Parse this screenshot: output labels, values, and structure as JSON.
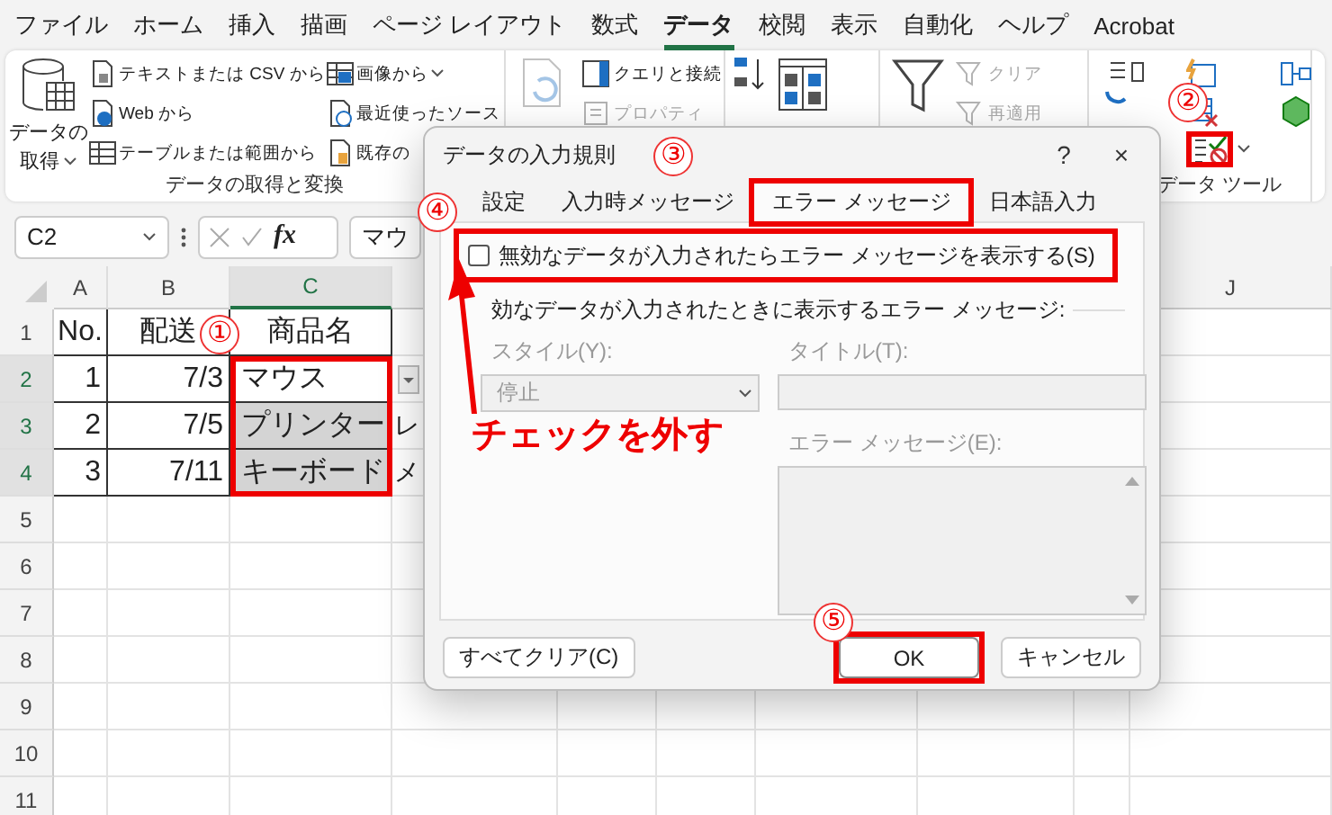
{
  "menu_tabs": [
    {
      "label": "ファイル",
      "selected": false
    },
    {
      "label": "ホーム",
      "selected": false
    },
    {
      "label": "挿入",
      "selected": false
    },
    {
      "label": "描画",
      "selected": false
    },
    {
      "label": "ページ レイアウト",
      "selected": false
    },
    {
      "label": "数式",
      "selected": false
    },
    {
      "label": "データ",
      "selected": true
    },
    {
      "label": "校閲",
      "selected": false
    },
    {
      "label": "表示",
      "selected": false
    },
    {
      "label": "自動化",
      "selected": false
    },
    {
      "label": "ヘルプ",
      "selected": false
    },
    {
      "label": "Acrobat",
      "selected": false
    }
  ],
  "ribbon": {
    "groups": [
      {
        "label": "データの取得と変換",
        "columns": [
          [
            {
              "kind": "large",
              "lines": [
                "データの",
                "取得"
              ],
              "caret": true,
              "disabled": false
            }
          ],
          [
            {
              "kind": "small",
              "label": "テキストまたは CSV から",
              "disabled": false
            },
            {
              "kind": "small",
              "label": "Web から",
              "disabled": false
            },
            {
              "kind": "small",
              "label": "テーブルまたは範囲から",
              "disabled": false
            }
          ],
          [
            {
              "kind": "small",
              "label": "画像から",
              "caret": true,
              "disabled": false
            },
            {
              "kind": "small",
              "label": "最近使ったソース",
              "disabled": false
            },
            {
              "kind": "small",
              "label": "既存の",
              "disabled": false
            }
          ]
        ]
      },
      {
        "columns": [
          [
            {
              "kind": "large",
              "disabled": true
            }
          ],
          [
            {
              "kind": "small",
              "label": "クエリと接続",
              "disabled": false
            },
            {
              "kind": "small",
              "label": "プロパティ",
              "disabled": true
            }
          ]
        ]
      },
      {
        "columns": [
          [
            {
              "kind": "icon",
              "disabled": false
            }
          ],
          [
            {
              "kind": "large",
              "disabled": false
            }
          ]
        ]
      },
      {
        "columns": [
          [
            {
              "kind": "large",
              "disabled": false
            }
          ],
          [
            {
              "kind": "small",
              "label": "クリア",
              "disabled": true
            },
            {
              "kind": "small",
              "label": "再適用",
              "disabled": true
            }
          ]
        ]
      },
      {
        "label": "データ ツール",
        "columns": [
          [
            {
              "kind": "large",
              "disabled": false
            }
          ],
          [
            {
              "kind": "icon",
              "disabled": false
            },
            {
              "kind": "icon",
              "disabled": false
            },
            {
              "kind": "icon",
              "caret": true,
              "disabled": false
            }
          ],
          [
            {
              "kind": "icon",
              "disabled": false
            },
            {
              "kind": "icon",
              "disabled": false
            }
          ]
        ]
      }
    ]
  },
  "formula_bar": {
    "name_box": "C2",
    "function_label": "fx",
    "content": "マウ"
  },
  "sheet": {
    "columns": [
      {
        "label": "A",
        "selected": false
      },
      {
        "label": "B",
        "selected": false
      },
      {
        "label": "C",
        "selected": true
      },
      {
        "label": "J",
        "selected": false
      }
    ],
    "rows": [
      {
        "header": "1",
        "selected": false,
        "cells": [
          {
            "text": "No.",
            "selected": false
          },
          {
            "text": "配送",
            "selected": false
          },
          {
            "text": "商品名",
            "selected": false
          }
        ]
      },
      {
        "header": "2",
        "selected": true,
        "cells": [
          {
            "text": "1",
            "selected": false
          },
          {
            "text": "7/3",
            "selected": false
          },
          {
            "text": "マウス",
            "selected": false
          },
          {
            "kind": "dropdown"
          }
        ]
      },
      {
        "header": "3",
        "selected": true,
        "cells": [
          {
            "text": "2",
            "selected": false
          },
          {
            "text": "7/5",
            "selected": false
          },
          {
            "text": "プリンター",
            "selected": true
          },
          {
            "text": "レ"
          }
        ]
      },
      {
        "header": "4",
        "selected": true,
        "cells": [
          {
            "text": "3",
            "selected": false
          },
          {
            "text": "7/11",
            "selected": false
          },
          {
            "text": "キーボード",
            "selected": true
          },
          {
            "text": "メ"
          }
        ]
      },
      {
        "header": "5",
        "selected": false
      },
      {
        "header": "6",
        "selected": false
      },
      {
        "header": "7",
        "selected": false
      },
      {
        "header": "8",
        "selected": false
      },
      {
        "header": "9",
        "selected": false
      },
      {
        "header": "10",
        "selected": false
      },
      {
        "header": "11",
        "selected": false
      }
    ]
  },
  "dialog": {
    "title": "データの入力規則",
    "help": "?",
    "close": "×",
    "tabs": [
      {
        "label": "設定",
        "selected": false
      },
      {
        "label": "入力時メッセージ",
        "selected": false
      },
      {
        "label": "エラー メッセージ",
        "selected": true
      },
      {
        "label": "日本語入力",
        "selected": false
      }
    ],
    "show_error_checkbox": {
      "label": "無効なデータが入力されたらエラー メッセージを表示する(S)",
      "checked": false
    },
    "group_label": "効なデータが入力されたときに表示するエラー メッセージ:",
    "style_field": {
      "label": "スタイル(Y):",
      "value": "停止",
      "disabled": true
    },
    "title_field": {
      "label": "タイトル(T):",
      "disabled": true
    },
    "message_field": {
      "label": "エラー メッセージ(E):",
      "disabled": true
    },
    "buttons": [
      {
        "label": "すべてクリア(C)",
        "kind": "secondary"
      },
      {
        "label": "OK",
        "kind": "default"
      },
      {
        "label": "キャンセル",
        "kind": "secondary"
      }
    ]
  },
  "annotations": {
    "steps": [
      "①",
      "②",
      "③",
      "④",
      "⑤"
    ],
    "callout": "チェックを外す"
  }
}
